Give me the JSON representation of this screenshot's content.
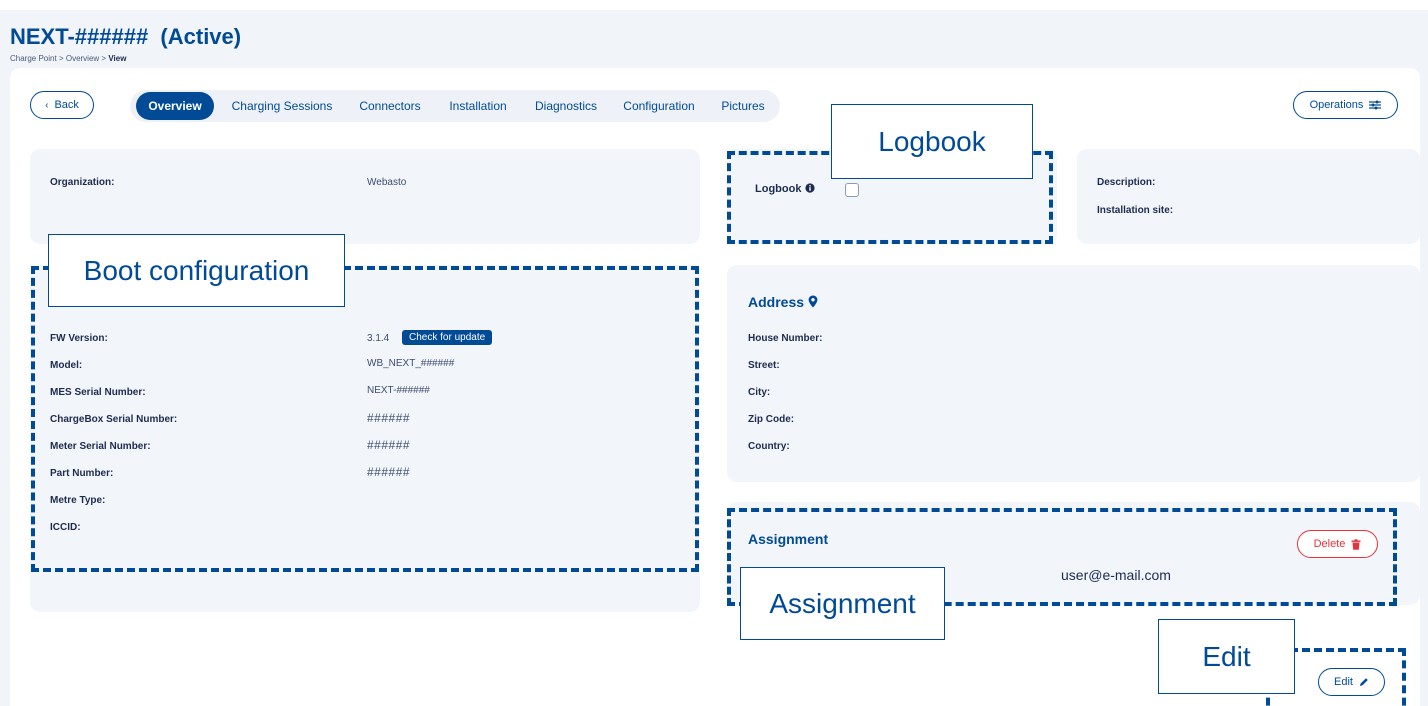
{
  "page": {
    "title": "NEXT-######  (Active)",
    "breadcrumb": [
      "Charge Point",
      ">",
      "Overview",
      ">",
      "View"
    ]
  },
  "toolbar": {
    "back_label": "Back",
    "back_icon": "chevron-left-icon",
    "operations_label": "Operations",
    "operations_icon": "sliders-icon"
  },
  "tabs": [
    {
      "label": "Overview",
      "active": true
    },
    {
      "label": "Charging Sessions",
      "active": false
    },
    {
      "label": "Connectors",
      "active": false
    },
    {
      "label": "Installation",
      "active": false
    },
    {
      "label": "Diagnostics",
      "active": false
    },
    {
      "label": "Configuration",
      "active": false
    },
    {
      "label": "Pictures",
      "active": false
    }
  ],
  "organization": {
    "label": "Organization:",
    "value": "Webasto"
  },
  "logbook": {
    "label": "Logbook",
    "info_icon": "info-circle-icon",
    "checked": false
  },
  "description": {
    "description_label": "Description:",
    "installation_site_label": "Installation site:"
  },
  "boot_configuration": {
    "fields": [
      {
        "label": "FW Version:",
        "value": "3.1.4"
      },
      {
        "label": "Model:",
        "value": "WB_NEXT_######"
      },
      {
        "label": "MES Serial Number:",
        "value": "NEXT-######"
      },
      {
        "label": "ChargeBox Serial Number:",
        "value": "######"
      },
      {
        "label": "Meter Serial Number:",
        "value": "######"
      },
      {
        "label": "Part Number:",
        "value": "######"
      },
      {
        "label": "Metre Type:",
        "value": ""
      },
      {
        "label": "ICCID:",
        "value": ""
      }
    ],
    "check_update_label": "Check for update"
  },
  "address": {
    "title": "Address",
    "icon": "map-marker-icon",
    "fields": [
      "House Number:",
      "Street:",
      "City:",
      "Zip Code:",
      "Country:"
    ]
  },
  "assignment": {
    "title": "Assignment",
    "email": "user@e-mail.com",
    "delete_label": "Delete",
    "delete_icon": "trash-icon"
  },
  "edit": {
    "label": "Edit",
    "icon": "pencil-icon"
  },
  "callouts": {
    "logbook": "Logbook",
    "boot_configuration": "Boot configuration",
    "assignment": "Assignment",
    "edit": "Edit"
  },
  "colors": {
    "brand": "#004a96",
    "panel": "#f2f5fa",
    "delete": "#e5323b"
  }
}
